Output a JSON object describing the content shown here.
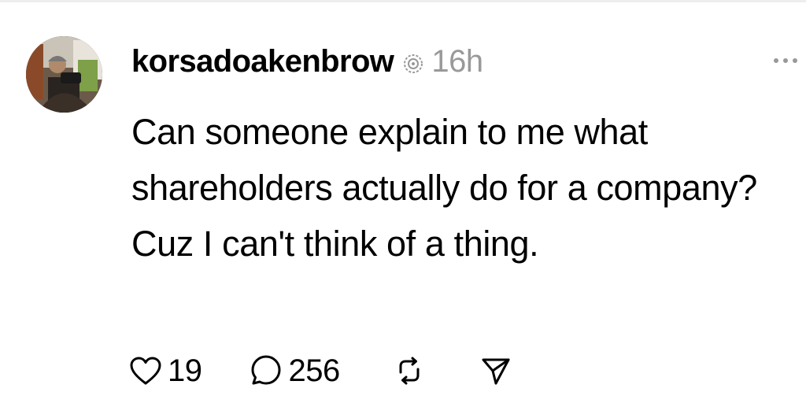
{
  "post": {
    "author": {
      "username": "korsadoakenbrow",
      "avatar_icon": "profile-photo",
      "verified_icon": "threads-badge-icon"
    },
    "timestamp": "16h",
    "text": "Can someone explain to me what shareholders actually do for a company? Cuz I can't think of a thing.",
    "more_icon": "more-horizontal-icon",
    "actions": {
      "like": {
        "icon": "heart-icon",
        "count": "19"
      },
      "reply": {
        "icon": "comment-icon",
        "count": "256"
      },
      "repost": {
        "icon": "repost-icon"
      },
      "share": {
        "icon": "send-icon"
      }
    }
  },
  "colors": {
    "text": "#000000",
    "muted": "#999999",
    "background": "#ffffff"
  }
}
